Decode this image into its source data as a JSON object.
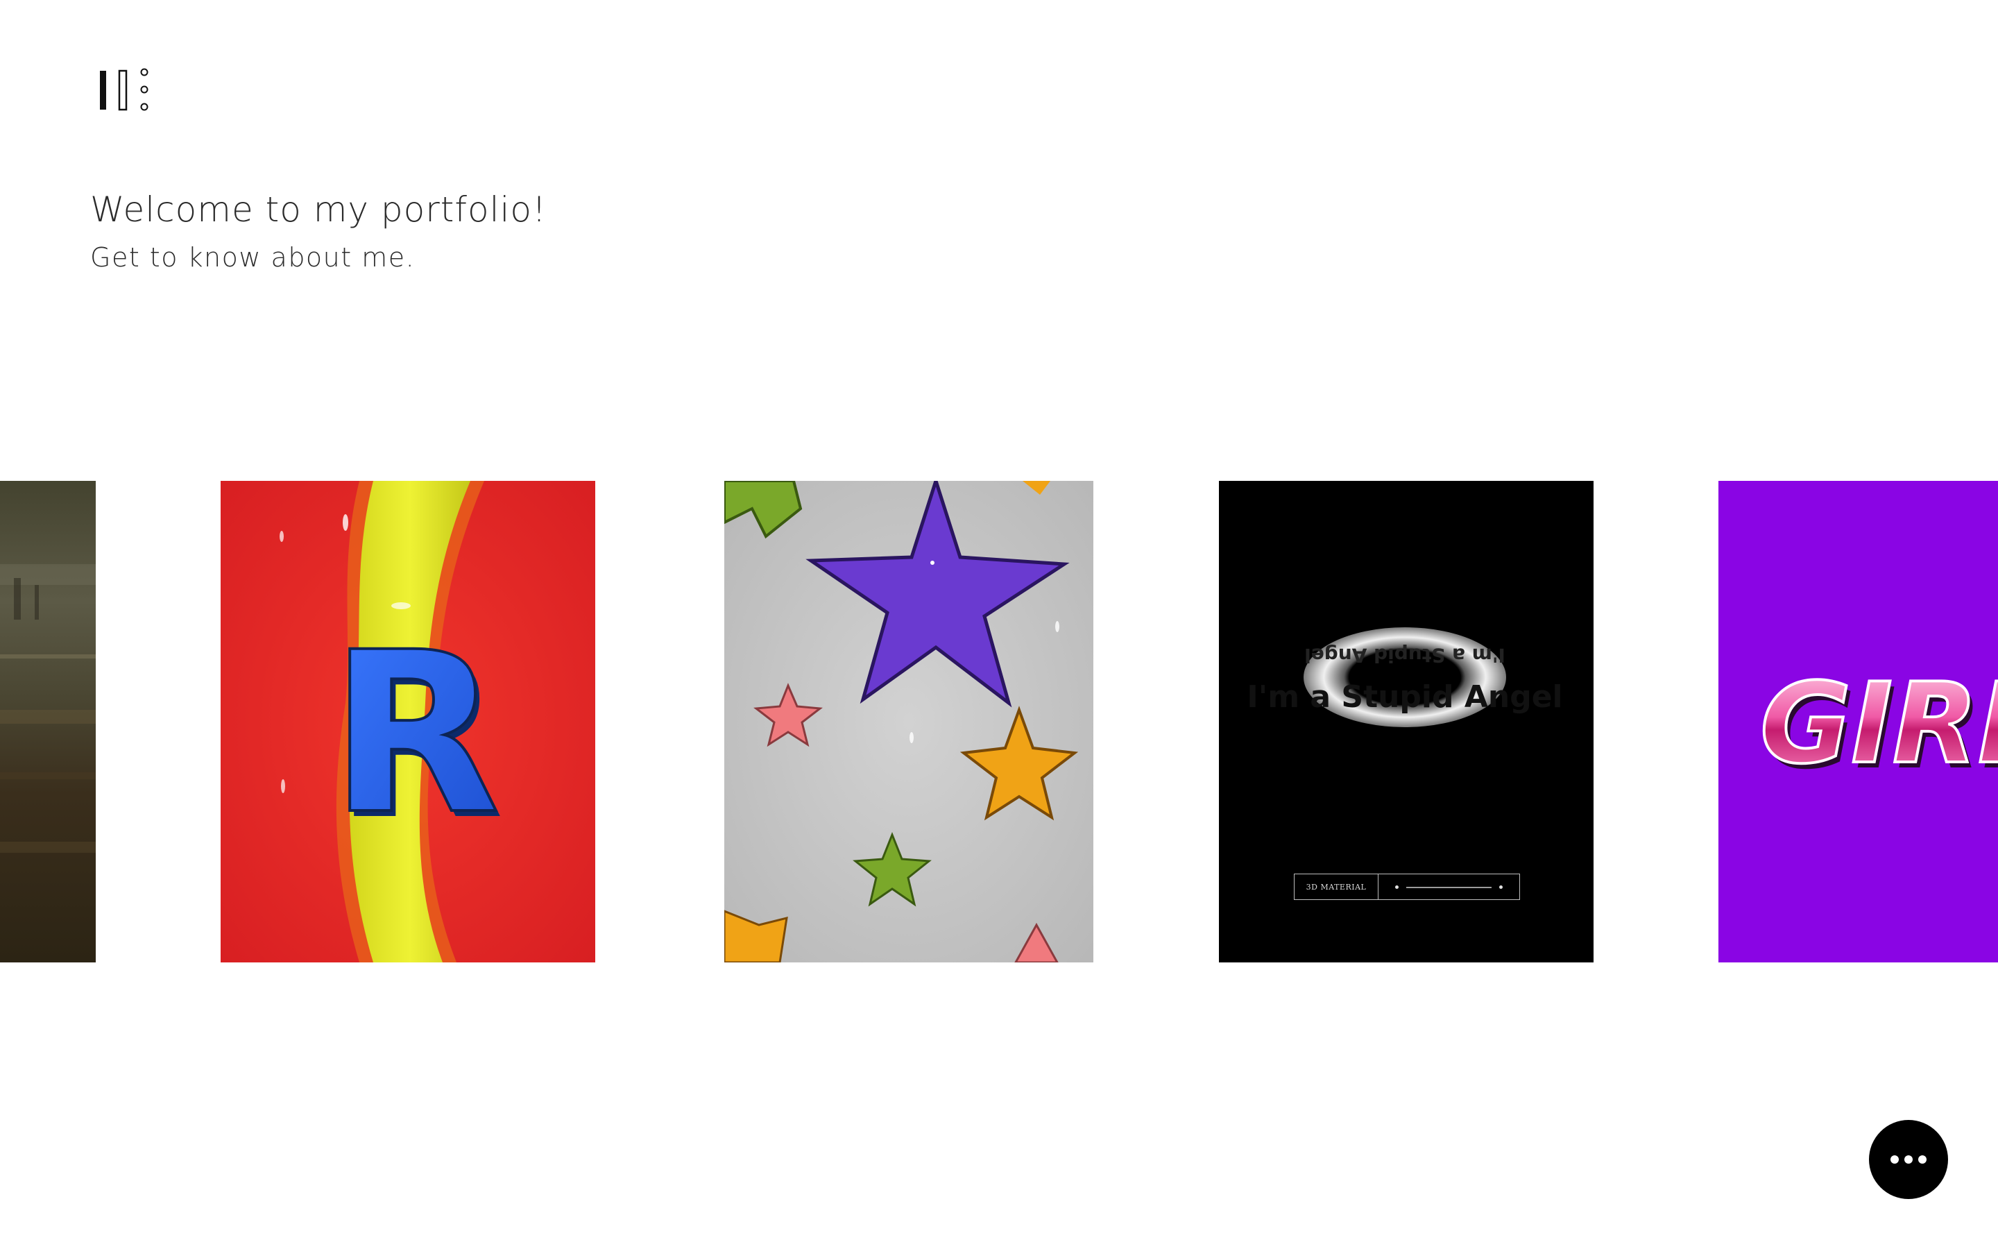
{
  "site": {
    "heading": "Welcome to my portfolio!",
    "subheading": "Get to know about me."
  },
  "logo": {
    "icon": "brand-logo-icon"
  },
  "gallery": {
    "items": [
      {
        "name": "gallery-item-abstract-photo",
        "colors": [
          "#3a3526",
          "#6e6a52",
          "#2e2616"
        ]
      },
      {
        "name": "gallery-item-letter-r",
        "text": "R",
        "colors": [
          "#e8242a",
          "#e3e92a",
          "#2b60e8"
        ]
      },
      {
        "name": "gallery-item-stars",
        "colors": [
          "#c4c4c4",
          "#6a3ad0",
          "#f0a316",
          "#f07a7e",
          "#7aa82a"
        ]
      },
      {
        "name": "gallery-item-stupid-angel",
        "ring_text": "I'm a Stupid Angel",
        "label": "3D MATERIAL",
        "colors": [
          "#000000",
          "#e8e8e8"
        ]
      },
      {
        "name": "gallery-item-girls",
        "text": "GIRLS",
        "colors": [
          "#8a05e4",
          "#e8318a"
        ]
      }
    ]
  },
  "chat": {
    "icon": "more-dots-icon"
  }
}
